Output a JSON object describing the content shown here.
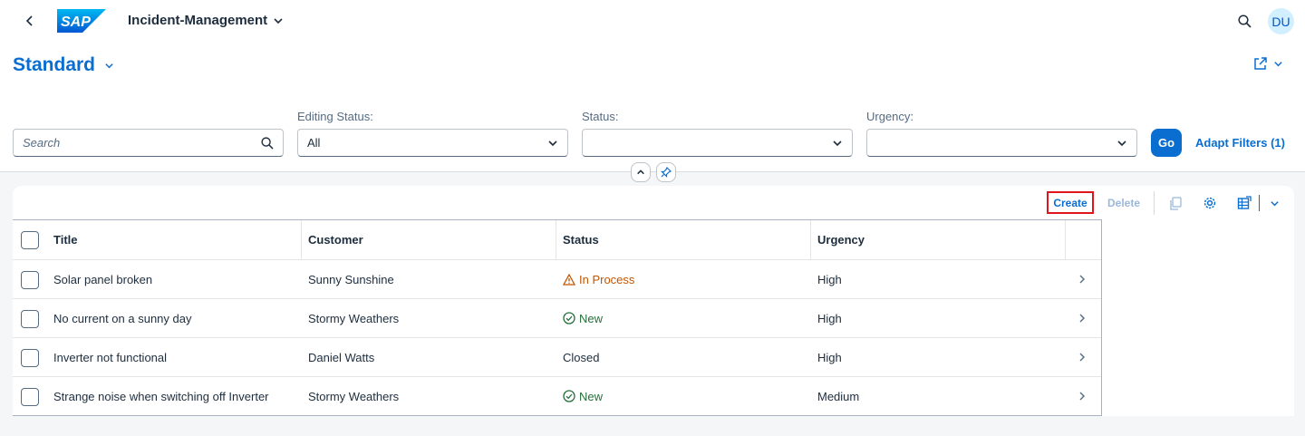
{
  "shell": {
    "logo_text": "SAP",
    "app_title": "Incident-Management",
    "avatar_initials": "DU"
  },
  "variant": {
    "title": "Standard"
  },
  "filters": {
    "search_placeholder": "Search",
    "editing_status": {
      "label": "Editing Status:",
      "value": "All"
    },
    "status": {
      "label": "Status:",
      "value": ""
    },
    "urgency": {
      "label": "Urgency:",
      "value": ""
    },
    "go_label": "Go",
    "adapt_label": "Adapt Filters (1)"
  },
  "toolbar": {
    "create_label": "Create",
    "delete_label": "Delete"
  },
  "table": {
    "columns": [
      "Title",
      "Customer",
      "Status",
      "Urgency"
    ],
    "rows": [
      {
        "title": "Solar panel broken",
        "customer": "Sunny Sunshine",
        "status": "In Process",
        "status_icon": "warning-icon",
        "urgency": "High"
      },
      {
        "title": "No current on a sunny day",
        "customer": "Stormy Weathers",
        "status": "New",
        "status_icon": "check-circle-icon",
        "urgency": "High"
      },
      {
        "title": "Inverter not functional",
        "customer": "Daniel Watts",
        "status": "Closed",
        "status_icon": "",
        "urgency": "High"
      },
      {
        "title": "Strange noise when switching off Inverter",
        "customer": "Stormy Weathers",
        "status": "New",
        "status_icon": "check-circle-icon",
        "urgency": "Medium"
      }
    ]
  },
  "colors": {
    "accent": "#0a6ed1",
    "warning": "#c35500",
    "success": "#256f3a",
    "highlight_border": "#e0141b"
  }
}
